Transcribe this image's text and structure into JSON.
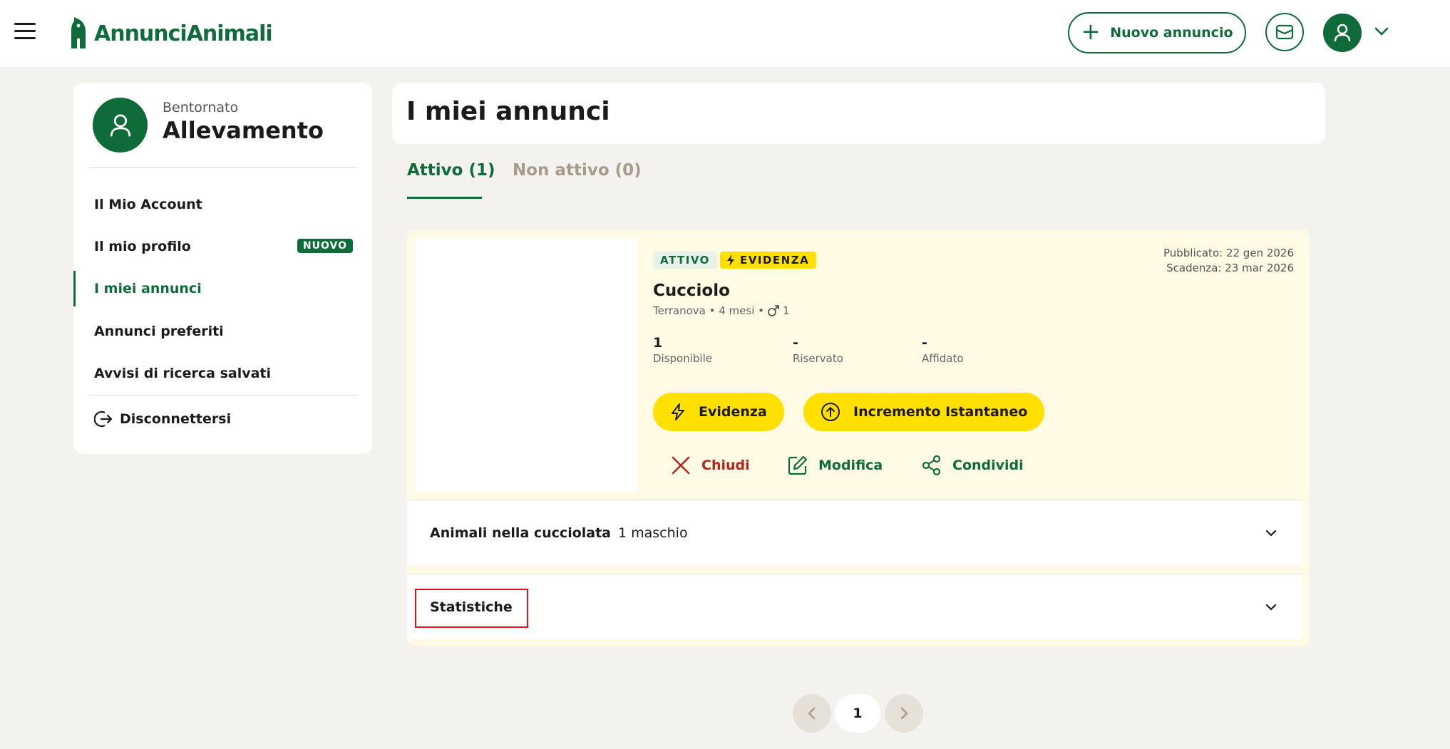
{
  "header": {
    "logo_text": "AnnunciAnimali",
    "new_ad_label": "Nuovo annuncio"
  },
  "sidebar": {
    "welcome": "Bentornato",
    "username": "Allevamento",
    "items": [
      {
        "label": "Il Mio Account"
      },
      {
        "label": "Il mio profilo",
        "badge": "NUOVO"
      },
      {
        "label": "I miei annunci"
      },
      {
        "label": "Annunci preferiti"
      },
      {
        "label": "Avvisi di ricerca salvati"
      }
    ],
    "logout": "Disconnettersi"
  },
  "main": {
    "title": "I miei annunci",
    "tabs": [
      {
        "label": "Attivo (1)"
      },
      {
        "label": "Non attivo (0)"
      }
    ],
    "listing": {
      "status": "ATTIVO",
      "promo": "EVIDENZA",
      "published": "Pubblicato: 22 gen 2026",
      "expires": "Scadenza: 23 mar 2026",
      "title": "Cucciolo",
      "subtitle": "Terranova • 4 mesi •",
      "male_count": "1",
      "stats": [
        {
          "value": "1",
          "label": "Disponibile"
        },
        {
          "value": "-",
          "label": "Riservato"
        },
        {
          "value": "-",
          "label": "Affidato"
        }
      ],
      "btn_evidenza": "Evidenza",
      "btn_incremento": "Incremento Istantaneo",
      "act_close": "Chiudi",
      "act_edit": "Modifica",
      "act_share": "Condividi",
      "litter_label": "Animali nella cucciolata",
      "litter_value": "1 maschio",
      "stats_label": "Statistiche"
    },
    "pagination": {
      "current": "1"
    }
  },
  "colors": {
    "brand_green": "#0f6b3a",
    "yellow": "#ffe000",
    "danger": "#b3251e",
    "background": "#f3f2ee"
  }
}
